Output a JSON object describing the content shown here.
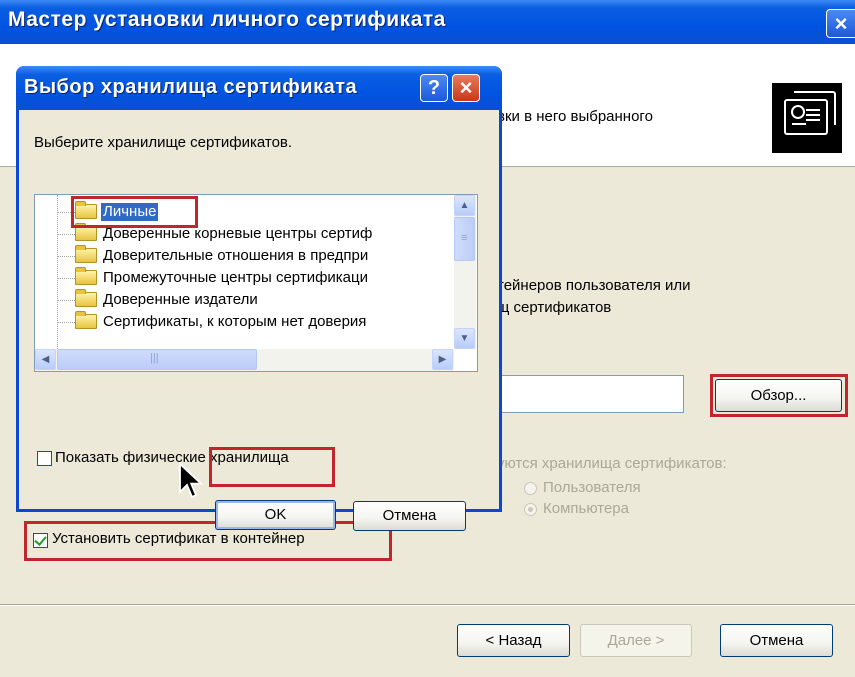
{
  "wizard": {
    "title": "Мастер установки личного сертификата",
    "close_icon": "×",
    "header_text": "вки в него  выбранного",
    "body_line1": "тейнеров пользователя или",
    "body_line2": "щ сертификатов",
    "browse_label": "Обзор...",
    "store_group_label": "уются хранилища сертификатов:",
    "radio_user": "Пользователя",
    "radio_computer": "Компьютера",
    "install_checkbox_label": "Установить сертификат в контейнер",
    "install_checkbox_checked": true,
    "back_label": "< Назад",
    "next_label": "Далее >",
    "cancel_label": "Отмена"
  },
  "dialog": {
    "title": "Выбор хранилища сертификата",
    "help_icon": "?",
    "close_icon": "×",
    "prompt": "Выберите хранилище сертификатов.",
    "stores": [
      "Личные",
      "Доверенные корневые центры сертиф",
      "Доверительные отношения в предпри",
      "Промежуточные центры сертификаци",
      "Доверенные издатели",
      "Сертификаты, к которым нет доверия"
    ],
    "selected_store": "Личные",
    "show_physical_label": "Показать физические хранилища",
    "show_physical_checked": false,
    "ok_label": "OK",
    "cancel_label": "Отмена"
  },
  "colors": {
    "titlebar": "#0054e3",
    "highlight_frame": "#c0262b",
    "selection": "#316ac5",
    "window_bg": "#ece9d8"
  }
}
